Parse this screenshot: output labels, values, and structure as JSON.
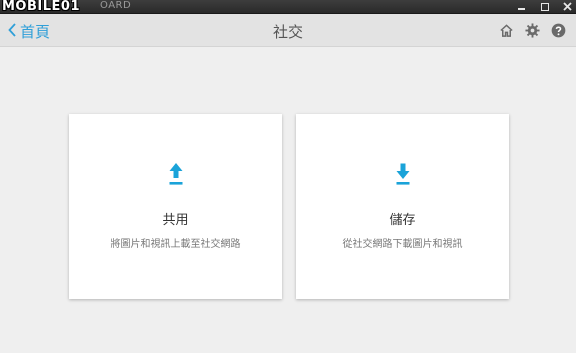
{
  "window": {
    "watermark": "MOBILE01",
    "app_name": "OARD"
  },
  "header": {
    "back_label": "首頁",
    "title": "社交",
    "icons": [
      "home-icon",
      "gear-icon",
      "help-icon"
    ]
  },
  "cards": [
    {
      "icon": "upload-icon",
      "title": "共用",
      "description": "將圖片和視訊上載至社交網路"
    },
    {
      "icon": "download-icon",
      "title": "儲存",
      "description": "從社交網路下載圖片和視訊"
    }
  ],
  "colors": {
    "accent": "#2f9fd8",
    "icon_blue": "#1aa3d9",
    "background": "#efefef",
    "header": "#e3e3e3"
  }
}
